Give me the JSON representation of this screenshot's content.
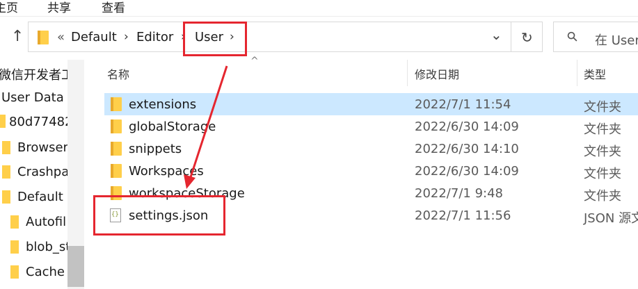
{
  "ribbon": {
    "home": "主页",
    "share": "共享",
    "view": "查看"
  },
  "nav": {
    "up_arrow": "↑",
    "up_icon": "up-arrow-icon"
  },
  "address": {
    "overflow": "«",
    "crumbs": [
      "Default",
      "Editor",
      "User"
    ],
    "chevron": "›",
    "dropdown": "⌄",
    "refresh": "↻"
  },
  "search": {
    "icon": "⚲",
    "placeholder": "在 User"
  },
  "columns": {
    "name": "名称",
    "date": "修改日期",
    "type": "类型",
    "sort_arrow": "^"
  },
  "files": [
    {
      "name": "extensions",
      "date": "2022/7/1 11:54",
      "type": "文件夹",
      "icon": "folder-icon",
      "selected": true
    },
    {
      "name": "globalStorage",
      "date": "2022/6/30 14:09",
      "type": "文件夹",
      "icon": "folder-icon",
      "selected": false
    },
    {
      "name": "snippets",
      "date": "2022/6/30 14:10",
      "type": "文件夹",
      "icon": "folder-icon",
      "selected": false
    },
    {
      "name": "Workspaces",
      "date": "2022/6/30 14:09",
      "type": "文件夹",
      "icon": "folder-icon",
      "selected": false
    },
    {
      "name": "workspaceStorage",
      "date": "2022/7/1 9:48",
      "type": "文件夹",
      "icon": "folder-icon",
      "selected": false
    },
    {
      "name": "settings.json",
      "date": "2022/7/1 11:56",
      "type": "JSON 源文",
      "icon": "json-file-icon",
      "selected": false
    }
  ],
  "sidebar": {
    "items": [
      {
        "label": "微信开发者工"
      },
      {
        "label": "User Data"
      },
      {
        "label": "80d77482"
      },
      {
        "label": "BrowserM"
      },
      {
        "label": "Crashpa"
      },
      {
        "label": "Default"
      },
      {
        "label": "Autofil"
      },
      {
        "label": "blob_st"
      },
      {
        "label": "Cache"
      }
    ],
    "scroll_up": "^"
  },
  "colors": {
    "selection": "#cce8ff",
    "annotation": "#e5262f",
    "folder": "#ffcf4a"
  }
}
